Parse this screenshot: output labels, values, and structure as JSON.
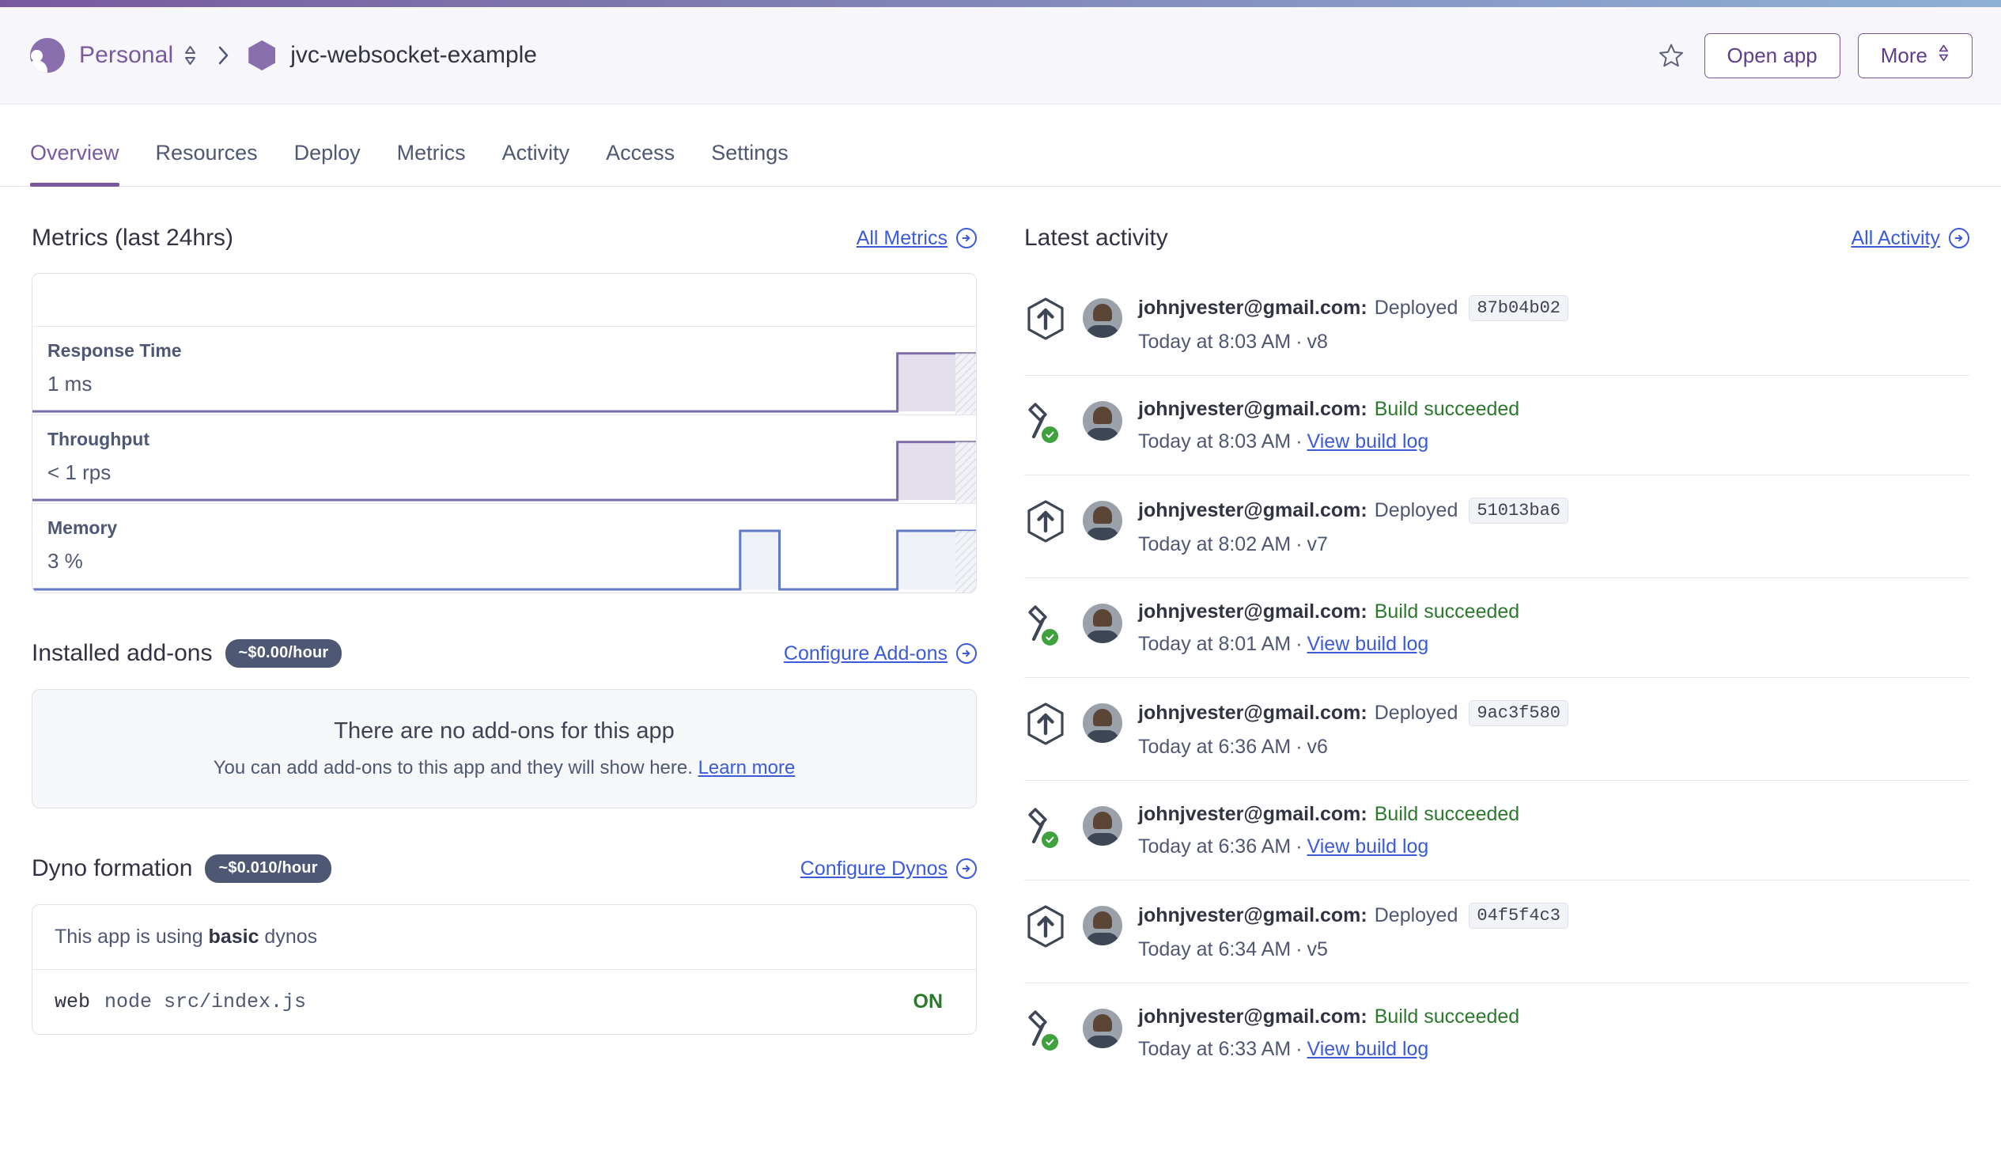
{
  "header": {
    "org_name": "Personal",
    "org_avatar_icon": "user-avatar-icon",
    "org_switcher_icon": "chevron-up-down-icon",
    "breadcrumb_separator_icon": "chevron-right-icon",
    "app_icon": "hexagon-app-icon",
    "app_name": "jvc-websocket-example",
    "star_icon": "star-outline-icon",
    "open_app_label": "Open app",
    "more_label": "More",
    "more_icon": "chevron-up-down-icon"
  },
  "tabs": [
    {
      "label": "Overview",
      "active": true
    },
    {
      "label": "Resources",
      "active": false
    },
    {
      "label": "Deploy",
      "active": false
    },
    {
      "label": "Metrics",
      "active": false
    },
    {
      "label": "Activity",
      "active": false
    },
    {
      "label": "Access",
      "active": false
    },
    {
      "label": "Settings",
      "active": false
    }
  ],
  "metrics": {
    "title": "Metrics (last 24hrs)",
    "link_label": "All Metrics",
    "link_icon": "arrow-right-circle-icon",
    "rows": [
      {
        "name": "Response Time",
        "value": "1 ms"
      },
      {
        "name": "Throughput",
        "value": "< 1 rps"
      },
      {
        "name": "Memory",
        "value": "3 %"
      }
    ]
  },
  "addons": {
    "title": "Installed add-ons",
    "cost_badge": "~$0.00/hour",
    "link_label": "Configure Add-ons",
    "link_icon": "arrow-right-circle-icon",
    "empty_title": "There are no add-ons for this app",
    "empty_subtitle": "You can add add-ons to this app and they will show here.",
    "learn_more_label": "Learn more"
  },
  "dynos": {
    "title": "Dyno formation",
    "cost_badge": "~$0.010/hour",
    "link_label": "Configure Dynos",
    "link_icon": "arrow-right-circle-icon",
    "note_prefix": "This app is using ",
    "note_plan": "basic",
    "note_suffix": " dynos",
    "row": {
      "type": "web",
      "command": "node src/index.js",
      "state": "ON"
    }
  },
  "activity": {
    "title": "Latest activity",
    "link_label": "All Activity",
    "link_icon": "arrow-right-circle-icon",
    "items": [
      {
        "icon": "deploy-hexagon-arrow-icon",
        "avatar": "user-photo-avatar",
        "user": "johnjvester@gmail.com:",
        "verb": "Deployed",
        "verb_style": "default",
        "commit": "87b04b02",
        "time": "Today at 8:03 AM",
        "meta": "v8",
        "meta_link": false
      },
      {
        "icon": "build-hammer-icon",
        "avatar": "user-photo-avatar",
        "user": "johnjvester@gmail.com:",
        "verb": "Build succeeded",
        "verb_style": "success",
        "commit": "",
        "time": "Today at 8:03 AM",
        "meta": "View build log",
        "meta_link": true
      },
      {
        "icon": "deploy-hexagon-arrow-icon",
        "avatar": "user-photo-avatar",
        "user": "johnjvester@gmail.com:",
        "verb": "Deployed",
        "verb_style": "default",
        "commit": "51013ba6",
        "time": "Today at 8:02 AM",
        "meta": "v7",
        "meta_link": false
      },
      {
        "icon": "build-hammer-icon",
        "avatar": "user-photo-avatar",
        "user": "johnjvester@gmail.com:",
        "verb": "Build succeeded",
        "verb_style": "success",
        "commit": "",
        "time": "Today at 8:01 AM",
        "meta": "View build log",
        "meta_link": true
      },
      {
        "icon": "deploy-hexagon-arrow-icon",
        "avatar": "user-photo-avatar",
        "user": "johnjvester@gmail.com:",
        "verb": "Deployed",
        "verb_style": "default",
        "commit": "9ac3f580",
        "time": "Today at 6:36 AM",
        "meta": "v6",
        "meta_link": false
      },
      {
        "icon": "build-hammer-icon",
        "avatar": "user-photo-avatar",
        "user": "johnjvester@gmail.com:",
        "verb": "Build succeeded",
        "verb_style": "success",
        "commit": "",
        "time": "Today at 6:36 AM",
        "meta": "View build log",
        "meta_link": true
      },
      {
        "icon": "deploy-hexagon-arrow-icon",
        "avatar": "user-photo-avatar",
        "user": "johnjvester@gmail.com:",
        "verb": "Deployed",
        "verb_style": "default",
        "commit": "04f5f4c3",
        "time": "Today at 6:34 AM",
        "meta": "v5",
        "meta_link": false
      },
      {
        "icon": "build-hammer-icon",
        "avatar": "user-photo-avatar",
        "user": "johnjvester@gmail.com:",
        "verb": "Build succeeded",
        "verb_style": "success",
        "commit": "",
        "time": "Today at 6:33 AM",
        "meta": "View build log",
        "meta_link": true
      }
    ]
  },
  "colors": {
    "brand_purple": "#79589f",
    "link_blue": "#3b5bdb",
    "success_green": "#2b7a2b",
    "badge_slate": "#4e5773",
    "spark_purple": "#7a6aa8",
    "spark_blue": "#5f79c8"
  },
  "chart_data": [
    {
      "type": "line",
      "title": "Response Time",
      "unit": "ms",
      "current_value": 1,
      "xlabel": "last 24hrs",
      "ylabel": "ms",
      "grid": false,
      "x": [
        0,
        1,
        2,
        3,
        4,
        5,
        6,
        7,
        8,
        9,
        10,
        11,
        12,
        13,
        14,
        15,
        16,
        17,
        18,
        19,
        20,
        21,
        22,
        23
      ],
      "values": [
        0,
        0,
        0,
        0,
        0,
        0,
        0,
        0,
        0,
        0,
        0,
        0,
        0,
        0,
        0,
        0,
        0,
        0,
        0,
        0,
        0,
        0,
        1,
        1
      ]
    },
    {
      "type": "line",
      "title": "Throughput",
      "unit": "rps",
      "current_value": 1,
      "xlabel": "last 24hrs",
      "ylabel": "rps",
      "grid": false,
      "x": [
        0,
        1,
        2,
        3,
        4,
        5,
        6,
        7,
        8,
        9,
        10,
        11,
        12,
        13,
        14,
        15,
        16,
        17,
        18,
        19,
        20,
        21,
        22,
        23
      ],
      "values": [
        0,
        0,
        0,
        0,
        0,
        0,
        0,
        0,
        0,
        0,
        0,
        0,
        0,
        0,
        0,
        0,
        0,
        0,
        0,
        0,
        0,
        0,
        1,
        1
      ]
    },
    {
      "type": "line",
      "title": "Memory",
      "unit": "%",
      "current_value": 3,
      "xlabel": "last 24hrs",
      "ylabel": "%",
      "grid": false,
      "x": [
        0,
        1,
        2,
        3,
        4,
        5,
        6,
        7,
        8,
        9,
        10,
        11,
        12,
        13,
        14,
        15,
        16,
        17,
        18,
        19,
        20,
        21,
        22,
        23
      ],
      "values": [
        0,
        0,
        0,
        0,
        0,
        0,
        0,
        0,
        0,
        0,
        0,
        0,
        0,
        0,
        0,
        0,
        0,
        0,
        3,
        0,
        0,
        0,
        3,
        3
      ]
    }
  ]
}
